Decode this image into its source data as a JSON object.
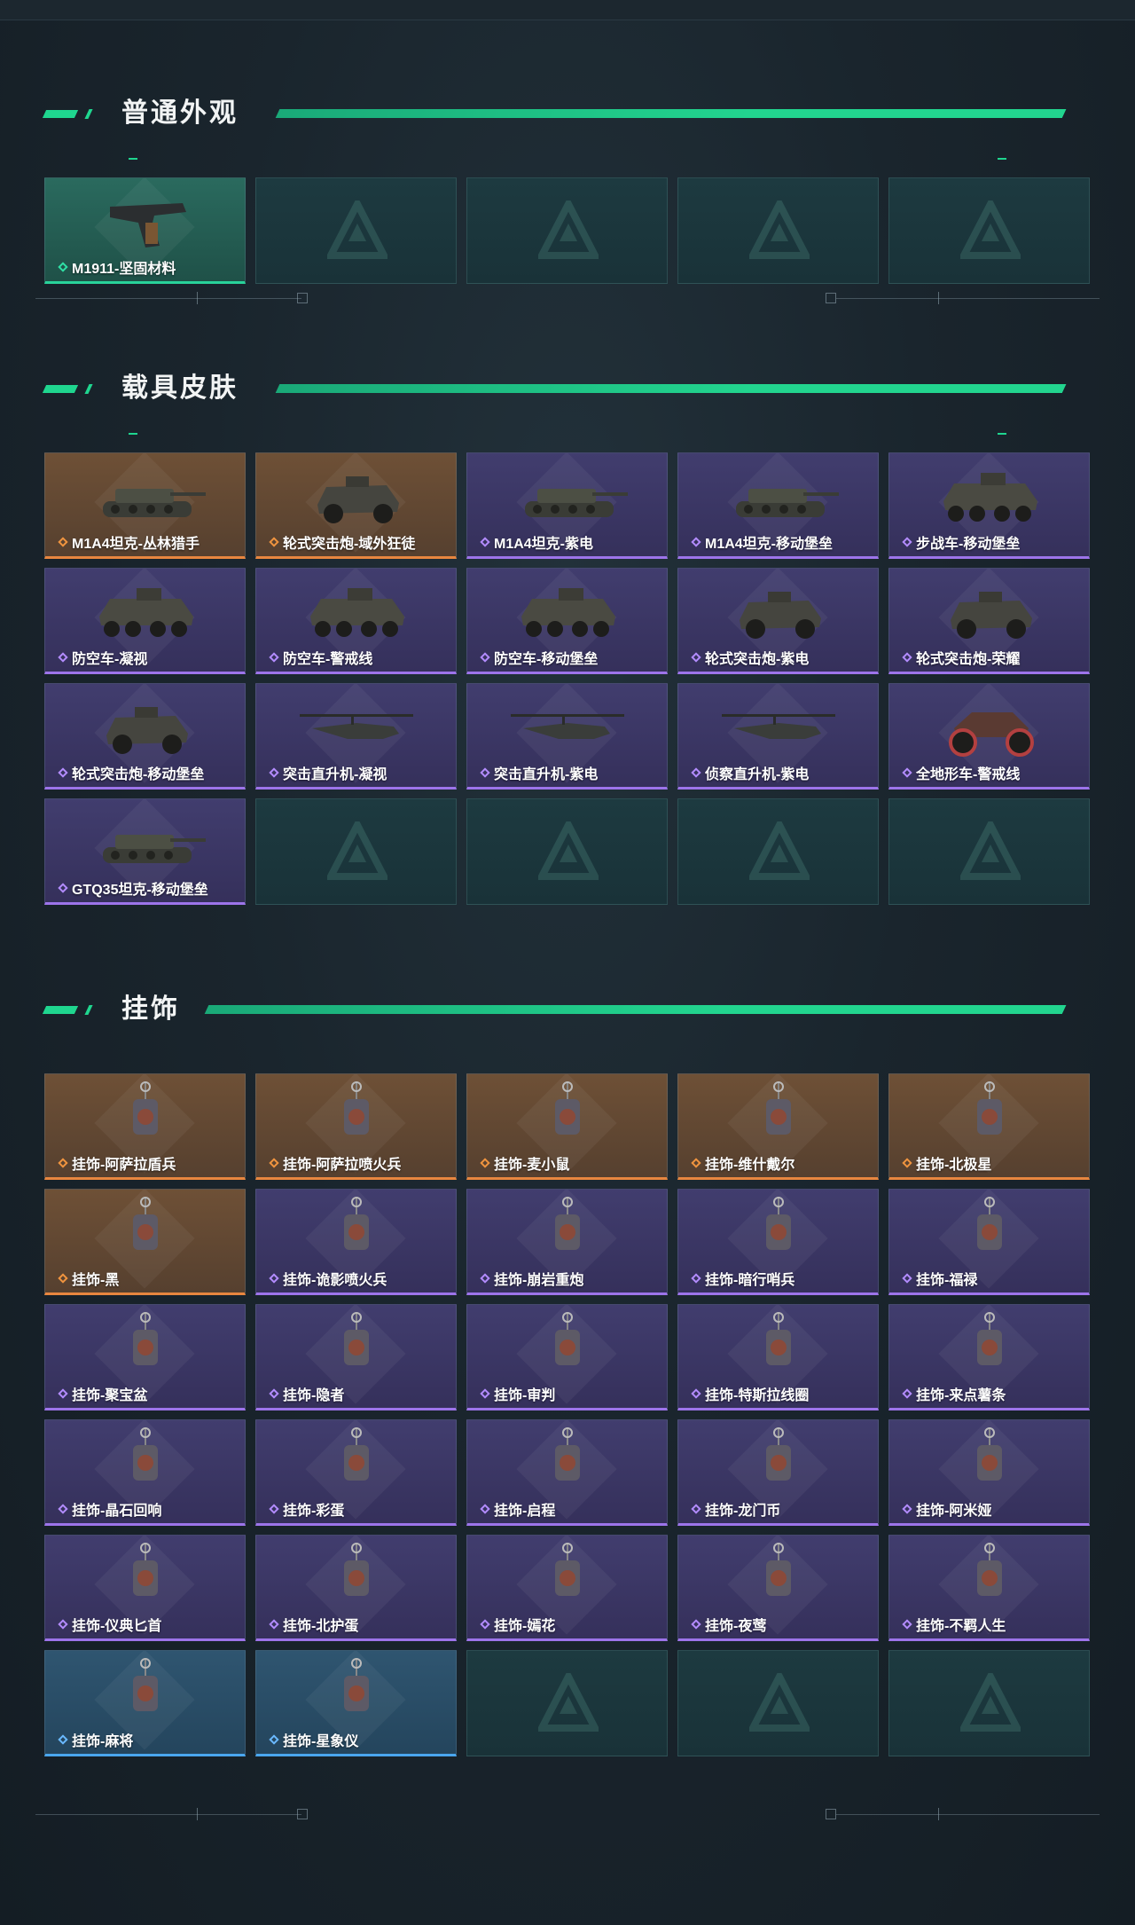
{
  "sections": [
    {
      "title": "普通外观",
      "items": [
        {
          "label": "M1911-坚固材料",
          "rarity": "green",
          "icon": "pistol-icon"
        },
        {
          "label": "",
          "rarity": "empty"
        },
        {
          "label": "",
          "rarity": "empty"
        },
        {
          "label": "",
          "rarity": "empty"
        },
        {
          "label": "",
          "rarity": "empty"
        }
      ]
    },
    {
      "title": "载具皮肤",
      "items": [
        {
          "label": "M1A4坦克-丛林猎手",
          "rarity": "orange",
          "icon": "tank-icon"
        },
        {
          "label": "轮式突击炮-域外狂徒",
          "rarity": "orange",
          "icon": "armored-car-icon"
        },
        {
          "label": "M1A4坦克-紫电",
          "rarity": "purple",
          "icon": "tank-icon"
        },
        {
          "label": "M1A4坦克-移动堡垒",
          "rarity": "purple",
          "icon": "tank-icon"
        },
        {
          "label": "步战车-移动堡垒",
          "rarity": "purple",
          "icon": "apc-icon"
        },
        {
          "label": "防空车-凝视",
          "rarity": "purple",
          "icon": "apc-icon"
        },
        {
          "label": "防空车-警戒线",
          "rarity": "purple",
          "icon": "apc-icon"
        },
        {
          "label": "防空车-移动堡垒",
          "rarity": "purple",
          "icon": "apc-icon"
        },
        {
          "label": "轮式突击炮-紫电",
          "rarity": "purple",
          "icon": "armored-car-icon"
        },
        {
          "label": "轮式突击炮-荣耀",
          "rarity": "purple",
          "icon": "armored-car-icon"
        },
        {
          "label": "轮式突击炮-移动堡垒",
          "rarity": "purple",
          "icon": "armored-car-icon"
        },
        {
          "label": "突击直升机-凝视",
          "rarity": "purple",
          "icon": "helicopter-icon"
        },
        {
          "label": "突击直升机-紫电",
          "rarity": "purple",
          "icon": "helicopter-icon"
        },
        {
          "label": "侦察直升机-紫电",
          "rarity": "purple",
          "icon": "helicopter-icon"
        },
        {
          "label": "全地形车-警戒线",
          "rarity": "purple",
          "icon": "atv-icon"
        },
        {
          "label": "GTQ35坦克-移动堡垒",
          "rarity": "purple",
          "icon": "tank-icon"
        },
        {
          "label": "",
          "rarity": "empty"
        },
        {
          "label": "",
          "rarity": "empty"
        },
        {
          "label": "",
          "rarity": "empty"
        },
        {
          "label": "",
          "rarity": "empty"
        }
      ]
    },
    {
      "title": "挂饰",
      "items": [
        {
          "label": "挂饰-阿萨拉盾兵",
          "rarity": "orange",
          "icon": "figure-charm-icon"
        },
        {
          "label": "挂饰-阿萨拉喷火兵",
          "rarity": "orange",
          "icon": "figure-charm-icon"
        },
        {
          "label": "挂饰-麦小鼠",
          "rarity": "orange",
          "icon": "mouse-charm-icon"
        },
        {
          "label": "挂饰-维什戴尔",
          "rarity": "orange",
          "icon": "tag-charm-icon"
        },
        {
          "label": "挂饰-北极星",
          "rarity": "orange",
          "icon": "star-charm-icon"
        },
        {
          "label": "挂饰-黑",
          "rarity": "orange",
          "icon": "tag-charm-icon"
        },
        {
          "label": "挂饰-诡影喷火兵",
          "rarity": "purple",
          "icon": "figure-charm-icon"
        },
        {
          "label": "挂饰-崩岩重炮",
          "rarity": "purple",
          "icon": "figure-charm-icon"
        },
        {
          "label": "挂饰-暗行哨兵",
          "rarity": "purple",
          "icon": "figure-charm-icon"
        },
        {
          "label": "挂饰-福禄",
          "rarity": "purple",
          "icon": "gourd-charm-icon"
        },
        {
          "label": "挂饰-聚宝盆",
          "rarity": "purple",
          "icon": "bowl-charm-icon"
        },
        {
          "label": "挂饰-隐者",
          "rarity": "purple",
          "icon": "card-charm-icon"
        },
        {
          "label": "挂饰-审判",
          "rarity": "purple",
          "icon": "card-charm-icon"
        },
        {
          "label": "挂饰-特斯拉线圈",
          "rarity": "purple",
          "icon": "coil-charm-icon"
        },
        {
          "label": "挂饰-来点薯条",
          "rarity": "purple",
          "icon": "fries-charm-icon"
        },
        {
          "label": "挂饰-晶石回响",
          "rarity": "purple",
          "icon": "crystal-charm-icon"
        },
        {
          "label": "挂饰-彩蛋",
          "rarity": "purple",
          "icon": "egg-charm-icon"
        },
        {
          "label": "挂饰-启程",
          "rarity": "purple",
          "icon": "compass-charm-icon"
        },
        {
          "label": "挂饰-龙门币",
          "rarity": "purple",
          "icon": "coin-charm-icon"
        },
        {
          "label": "挂饰-阿米娅",
          "rarity": "purple",
          "icon": "figure-charm-icon"
        },
        {
          "label": "挂饰-仪典匕首",
          "rarity": "purple",
          "icon": "dagger-charm-icon"
        },
        {
          "label": "挂饰-北护蛋",
          "rarity": "purple",
          "icon": "egg-charm-icon"
        },
        {
          "label": "挂饰-嫣花",
          "rarity": "purple",
          "icon": "flower-charm-icon"
        },
        {
          "label": "挂饰-夜莺",
          "rarity": "purple",
          "icon": "feather-charm-icon"
        },
        {
          "label": "挂饰-不羁人生",
          "rarity": "purple",
          "icon": "shoe-charm-icon"
        },
        {
          "label": "挂饰-麻将",
          "rarity": "blue",
          "icon": "mahjong-charm-icon"
        },
        {
          "label": "挂饰-星象仪",
          "rarity": "blue",
          "icon": "orrery-charm-icon"
        },
        {
          "label": "",
          "rarity": "empty"
        },
        {
          "label": "",
          "rarity": "empty"
        },
        {
          "label": "",
          "rarity": "empty"
        }
      ]
    }
  ],
  "colors": {
    "accent": "#22d58f",
    "green": "#29d29a",
    "orange": "#e8863f",
    "purple": "#9d74ea",
    "blue": "#4aa6ee"
  }
}
